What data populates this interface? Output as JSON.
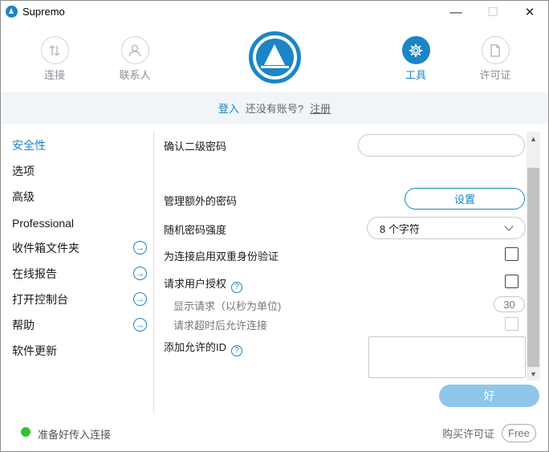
{
  "window": {
    "title": "Supremo",
    "controls": {
      "minimize": "—",
      "maximize": "☐",
      "close": "✕"
    }
  },
  "nav": {
    "items": [
      {
        "key": "connect",
        "label": "连接",
        "icon": "arrows-updown-icon",
        "active": false
      },
      {
        "key": "contacts",
        "label": "联系人",
        "icon": "person-icon",
        "active": false
      },
      {
        "key": "tools",
        "label": "工具",
        "icon": "gear-icon",
        "active": true
      },
      {
        "key": "license",
        "label": "许可证",
        "icon": "document-icon",
        "active": false
      }
    ]
  },
  "login": {
    "login_label": "登入",
    "question": "还没有账号?",
    "signup_label": "注册"
  },
  "sidebar": {
    "items": [
      {
        "label": "安全性",
        "active": true,
        "arrow": false
      },
      {
        "label": "选项",
        "active": false,
        "arrow": false
      },
      {
        "label": "高级",
        "active": false,
        "arrow": false
      },
      {
        "label": "Professional",
        "active": false,
        "arrow": false
      },
      {
        "label": "收件箱文件夹",
        "active": false,
        "arrow": true
      },
      {
        "label": "在线报告",
        "active": false,
        "arrow": true
      },
      {
        "label": "打开控制台",
        "active": false,
        "arrow": true
      },
      {
        "label": "帮助",
        "active": false,
        "arrow": true
      },
      {
        "label": "软件更新",
        "active": false,
        "arrow": false
      }
    ]
  },
  "settings": {
    "confirm_password_label": "确认二级密码",
    "confirm_password_value": "",
    "extra_password_label": "管理额外的密码",
    "set_button": "设置",
    "random_strength_label": "随机密码强度",
    "random_strength_value": "8 个字符",
    "two_factor_label": "为连接启用双重身份验证",
    "two_factor_checked": false,
    "request_auth_label": "请求用户授权",
    "request_auth_checked": false,
    "show_request_label": "显示请求（以秒为单位)",
    "show_request_value": "30",
    "allow_on_timeout_label": "请求超时后允许连接",
    "allow_on_timeout_checked": false,
    "add_allowed_id_label": "添加允许的ID",
    "allowed_ids_value": "",
    "help_glyph": "?"
  },
  "actions": {
    "ok_label": "好"
  },
  "footer": {
    "status_text": "准备好传入连接",
    "status_color": "#2ec52e",
    "buy_license_label": "购买许可证",
    "edition_badge": "Free"
  },
  "colors": {
    "accent": "#1b85c8",
    "ok_button": "#8ec7ea"
  }
}
